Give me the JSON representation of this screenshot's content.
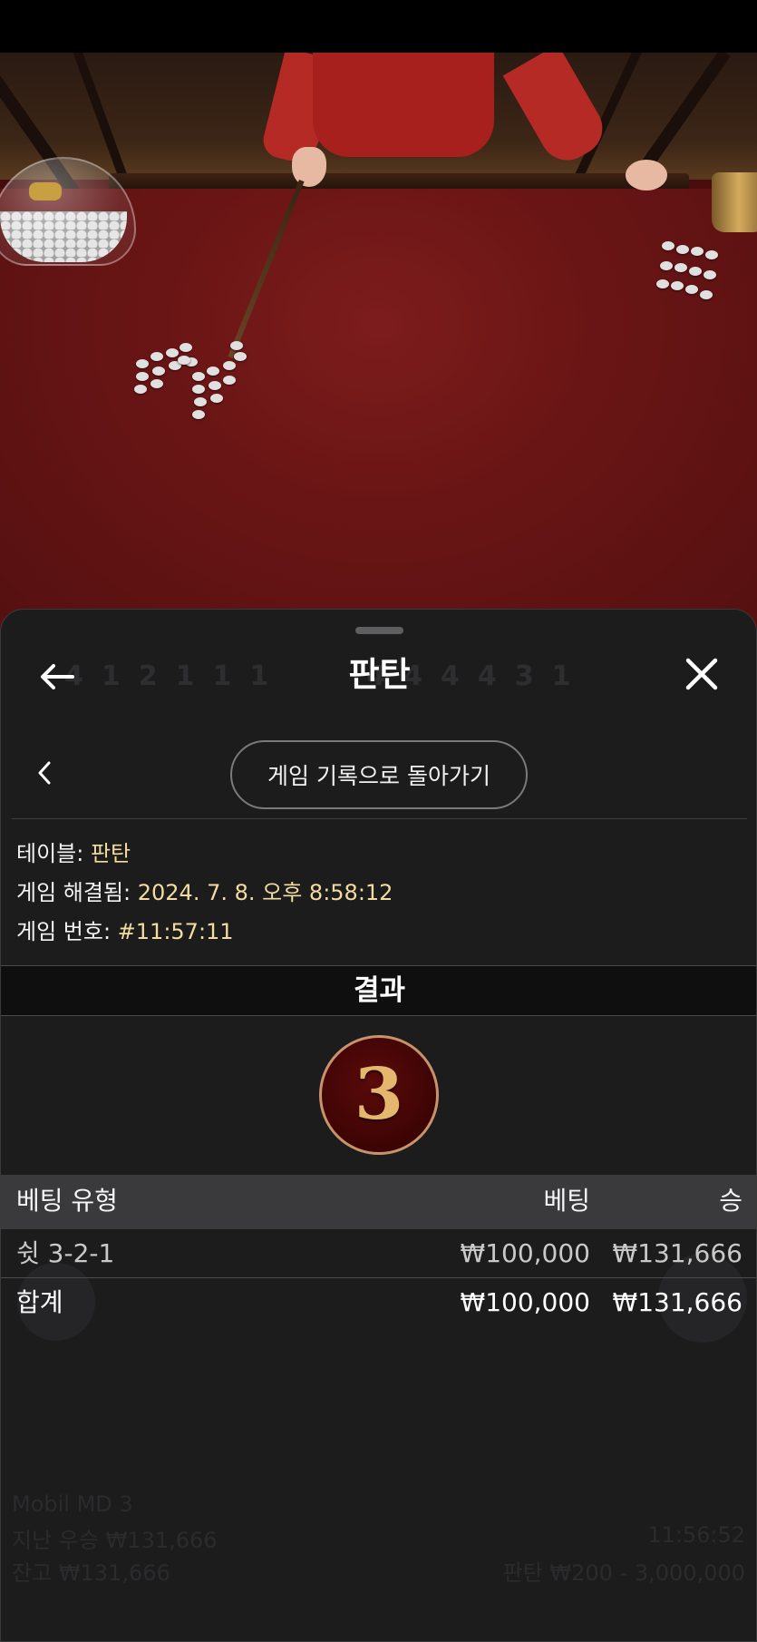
{
  "sheet": {
    "title": "판탄",
    "back_to_history": "게임 기록으로 돌아가기",
    "ghost_digits": [
      "4",
      "1",
      "2",
      "1",
      "1",
      "1",
      "4",
      "4",
      "4",
      "4",
      "3",
      "1"
    ]
  },
  "details": {
    "table_label": "테이블: ",
    "table_value": "판탄",
    "resolved_label": "게임 해결됨: ",
    "resolved_value": "2024. 7. 8. 오후 8:58:12",
    "number_label": "게임 번호: ",
    "number_value": "#11:57:11"
  },
  "result": {
    "heading": "결과",
    "number": "3"
  },
  "bets": {
    "headers": {
      "type": "베팅 유형",
      "bet": "베팅",
      "win": "승"
    },
    "rows": [
      {
        "type": "쉿 3-2-1",
        "bet": "₩100,000",
        "win": "₩131,666"
      }
    ],
    "total": {
      "label": "합계",
      "bet": "₩100,000",
      "win": "₩131,666"
    }
  },
  "background_ui": {
    "player": "Mobil MD 3",
    "last_win": "지난 우승 ₩131,666",
    "balance": "잔고 ₩131,666",
    "timer": "11:56:52",
    "limits": "판탄 ₩200 - 3,000,000"
  },
  "colors": {
    "sheet_bg": "#1c1c1d",
    "accent_value": "#f2dca0",
    "ball_number": "#e5b66e",
    "ball_bg": "#3d0404"
  }
}
